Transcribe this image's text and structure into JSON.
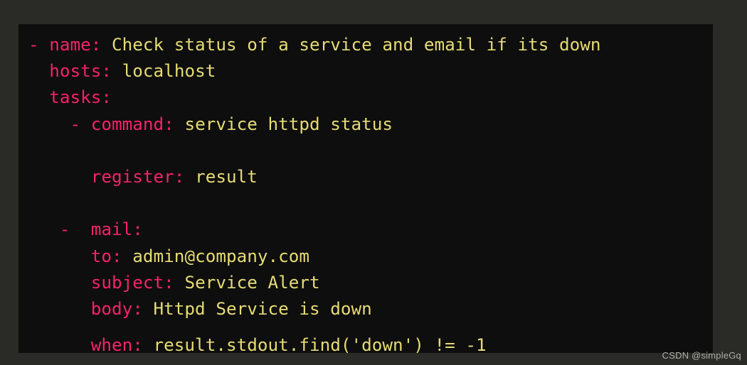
{
  "theme": {
    "outer_background": "#2a2b26",
    "code_background": "#0e0e0e",
    "key_color": "#f4236a",
    "value_color": "#e6db74",
    "watermark_color": "#b9bab5"
  },
  "code": {
    "language": "yaml",
    "lines": [
      {
        "indent": "",
        "dash": "- ",
        "key": "name:",
        "value": " Check status of a service and email if its down"
      },
      {
        "indent": "  ",
        "dash": "",
        "key": "hosts:",
        "value": " localhost"
      },
      {
        "indent": "  ",
        "dash": "",
        "key": "tasks:",
        "value": ""
      },
      {
        "indent": "    ",
        "dash": "- ",
        "key": "command:",
        "value": " service httpd status"
      },
      {
        "blank": true
      },
      {
        "indent": "      ",
        "dash": "",
        "key": "register:",
        "value": " result"
      },
      {
        "blank": true
      },
      {
        "indent": "   ",
        "dash": "- ",
        "key": " mail:",
        "value": ""
      },
      {
        "indent": "      ",
        "dash": "",
        "key": "to:",
        "value": " admin@company.com"
      },
      {
        "indent": "      ",
        "dash": "",
        "key": "subject:",
        "value": " Service Alert"
      },
      {
        "indent": "      ",
        "dash": "",
        "key": "body:",
        "value": " Httpd Service is down"
      },
      {
        "half_blank": true
      },
      {
        "indent": "      ",
        "dash": "",
        "key": "when:",
        "value": " result.stdout.find('down') != -1"
      }
    ],
    "plain_text": "- name: Check status of a service and email if its down\n  hosts: localhost\n  tasks:\n    - command: service httpd status\n\n      register: result\n\n    - mail:\n        to: admin@company.com\n        subject: Service Alert\n        body: Httpd Service is down\n\n        when: result.stdout.find('down') != -1"
  },
  "watermark": {
    "text": "CSDN @simpleGq"
  }
}
